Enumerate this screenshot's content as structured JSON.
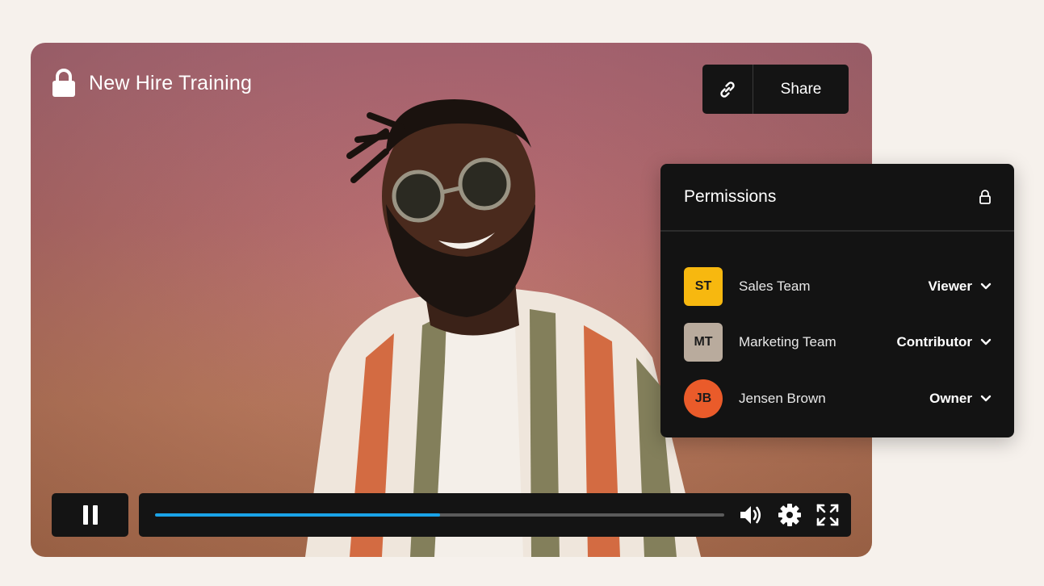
{
  "video": {
    "title": "New Hire Training",
    "progress_fraction": 0.5,
    "share_label": "Share"
  },
  "icons": {
    "title_lock": "lock-icon",
    "share_link": "link-icon",
    "pause": "pause-icon",
    "volume": "volume-icon",
    "settings": "gear-icon",
    "fullscreen": "fullscreen-icon",
    "permissions_lock": "lock-icon",
    "role_dropdown": "chevron-down-icon"
  },
  "permissions": {
    "title": "Permissions",
    "members": [
      {
        "initials": "ST",
        "name": "Sales Team",
        "role": "Viewer",
        "avatar_color": "#f7b80f",
        "shape": "square"
      },
      {
        "initials": "MT",
        "name": "Marketing Team",
        "role": "Contributor",
        "avatar_color": "#b9ab9d",
        "shape": "square"
      },
      {
        "initials": "JB",
        "name": "Jensen Brown",
        "role": "Owner",
        "avatar_color": "#ea5b2a",
        "shape": "round"
      }
    ]
  },
  "colors": {
    "progress": "#1aa3e8",
    "panel": "#131313",
    "page_bg": "#f6f1ec"
  }
}
